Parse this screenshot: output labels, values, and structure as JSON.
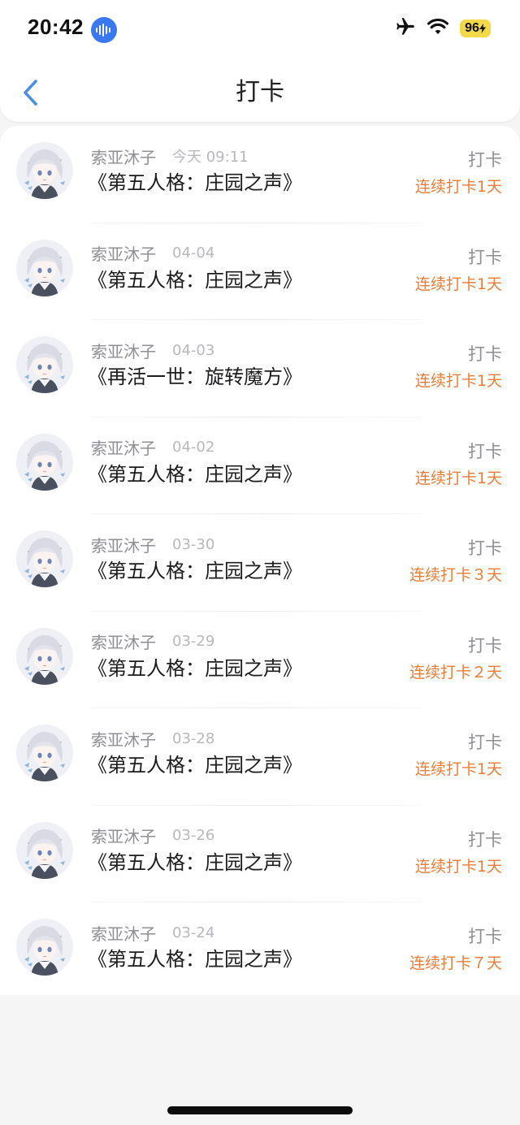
{
  "status_bar": {
    "time": "20:42",
    "voice_icon": "waveform-icon",
    "airplane_icon": "airplane-icon",
    "wifi_icon": "wifi-icon",
    "battery_level": "96",
    "battery_color": "#f3d84a",
    "voice_badge_color": "#3a78f2"
  },
  "nav": {
    "back_icon": "chevron-left-icon",
    "title": "打卡",
    "accent_color": "#4a90e2"
  },
  "colors": {
    "streak": "#ec7d37",
    "username": "#8f8f95",
    "date": "#b8b8bd",
    "title": "#1c1c1e",
    "action": "#8e8e93"
  },
  "checkins": [
    {
      "user": "索亚沐子",
      "date": "今天 09:11",
      "game": "《第五人格：庄园之声》",
      "action": "打卡",
      "streak": "连续打卡1天"
    },
    {
      "user": "索亚沐子",
      "date": "04-04",
      "game": "《第五人格：庄园之声》",
      "action": "打卡",
      "streak": "连续打卡1天"
    },
    {
      "user": "索亚沐子",
      "date": "04-03",
      "game": "《再活一世：旋转魔方》",
      "action": "打卡",
      "streak": "连续打卡1天"
    },
    {
      "user": "索亚沐子",
      "date": "04-02",
      "game": "《第五人格：庄园之声》",
      "action": "打卡",
      "streak": "连续打卡1天"
    },
    {
      "user": "索亚沐子",
      "date": "03-30",
      "game": "《第五人格：庄园之声》",
      "action": "打卡",
      "streak": "连续打卡３天"
    },
    {
      "user": "索亚沐子",
      "date": "03-29",
      "game": "《第五人格：庄园之声》",
      "action": "打卡",
      "streak": "连续打卡２天"
    },
    {
      "user": "索亚沐子",
      "date": "03-28",
      "game": "《第五人格：庄园之声》",
      "action": "打卡",
      "streak": "连续打卡1天"
    },
    {
      "user": "索亚沐子",
      "date": "03-26",
      "game": "《第五人格：庄园之声》",
      "action": "打卡",
      "streak": "连续打卡1天"
    },
    {
      "user": "索亚沐子",
      "date": "03-24",
      "game": "《第五人格：庄园之声》",
      "action": "打卡",
      "streak": "连续打卡７天"
    }
  ]
}
